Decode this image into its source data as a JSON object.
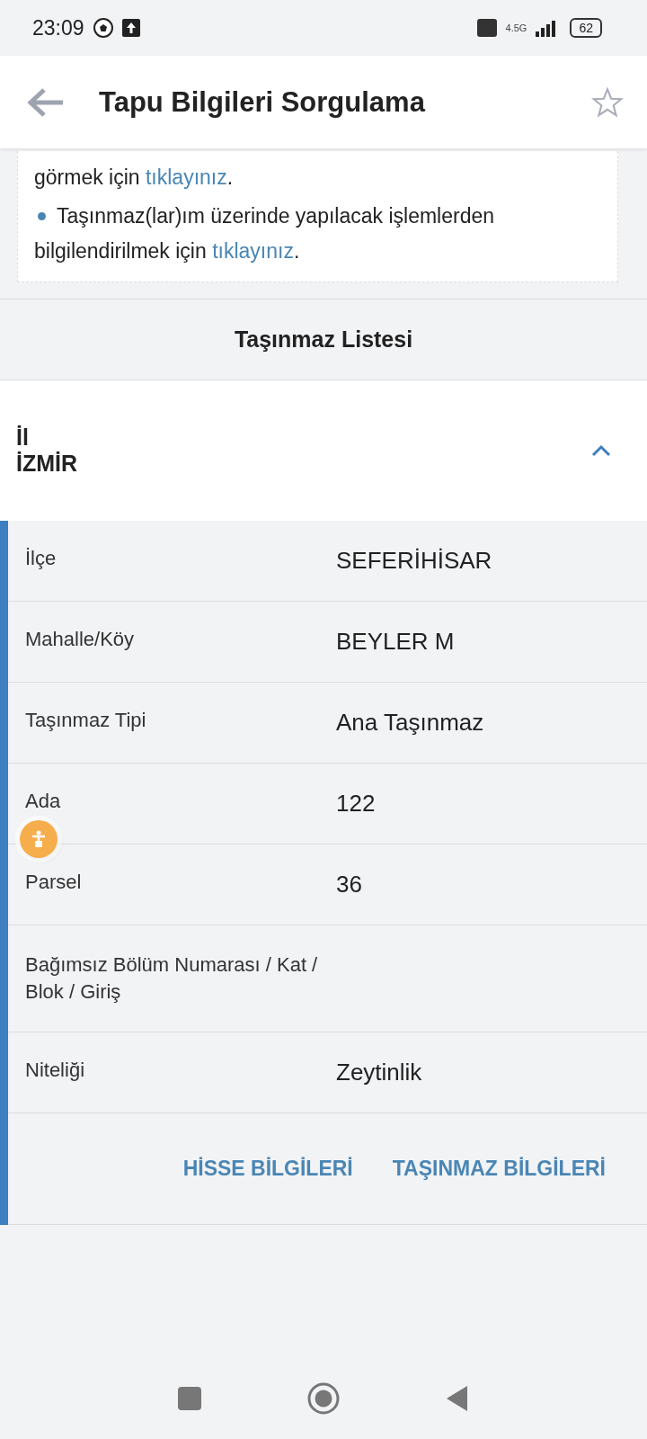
{
  "status_bar": {
    "time": "23:09",
    "network": "4.5G",
    "battery": "62"
  },
  "app_bar": {
    "title": "Tapu Bilgileri Sorgulama",
    "favorite": false
  },
  "info_card": {
    "items": [
      {
        "bullet": false,
        "parts": [
          {
            "kind": "text",
            "text": "görmek için "
          },
          {
            "kind": "link",
            "text": "tıklayınız"
          },
          {
            "kind": "text",
            "text": "."
          }
        ]
      },
      {
        "bullet": true,
        "parts": [
          {
            "kind": "text",
            "text": "Taşınmaz(lar)ım üzerinde yapılacak işlemlerden bilgilendirilmek için "
          },
          {
            "kind": "link",
            "text": "tıklayınız"
          },
          {
            "kind": "text",
            "text": "."
          }
        ]
      }
    ]
  },
  "list_title": "Taşınmaz Listesi",
  "property": {
    "label": "İl",
    "value": "İZMİR",
    "expanded": true,
    "rows": [
      {
        "label": "İlçe",
        "value": "SEFERİHİSAR"
      },
      {
        "label": "Mahalle/Köy",
        "value": "BEYLER M"
      },
      {
        "label": "Taşınmaz Tipi",
        "value": "Ana Taşınmaz"
      },
      {
        "label": "Ada",
        "value": "122"
      },
      {
        "label": "Parsel",
        "value": "36"
      },
      {
        "label": "Bağımsız Bölüm Numarası / Kat / Blok / Giriş"
      },
      {
        "label": "Niteliği",
        "value": "Zeytinlik"
      }
    ],
    "buttons": [
      "HİSSE BİLGİLERİ",
      "TAŞINMAZ BİLGİLERİ"
    ]
  }
}
